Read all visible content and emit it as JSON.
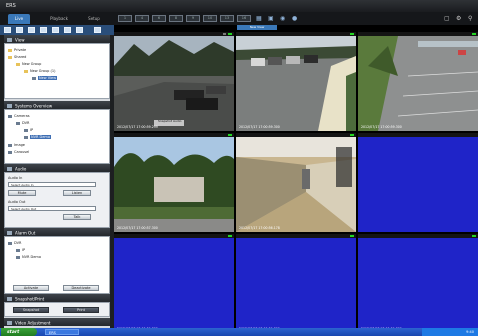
{
  "app": {
    "title": "ERS"
  },
  "tabs": [
    "Live",
    "Playback",
    "Setup"
  ],
  "toolbar": {
    "layout_buttons": [
      "1",
      "4",
      "6",
      "8",
      "9",
      "10",
      "13",
      "16",
      "25",
      "36"
    ],
    "right_icons": [
      "window-icon",
      "gear-icon",
      "search-icon"
    ],
    "extra_icons": [
      "sequence-icon",
      "fullscreen-icon",
      "snapshot-icon",
      "record-icon"
    ]
  },
  "view_tab": "New View",
  "view_panel": {
    "title": "View",
    "tree": [
      {
        "label": "Private",
        "level": 0
      },
      {
        "label": "Shared",
        "level": 0
      },
      {
        "label": "New Group",
        "level": 1
      },
      {
        "label": "New Group (1)",
        "level": 2
      },
      {
        "label": "New View",
        "level": 3,
        "selected": true
      }
    ]
  },
  "systems_panel": {
    "title": "Systems Overview",
    "tree": [
      {
        "label": "Cameras",
        "level": 0
      },
      {
        "label": "DVR",
        "level": 1
      },
      {
        "label": "IP",
        "level": 2
      },
      {
        "label": "NVR Demo",
        "level": 2,
        "selected": true
      },
      {
        "label": "Image",
        "level": 0
      },
      {
        "label": "Carousel",
        "level": 0
      }
    ]
  },
  "audio_panel": {
    "title": "Audio",
    "audio_in_label": "Audio In",
    "audio_in_placeholder": "Select Audio In",
    "mute_label": "Mute",
    "listen_label": "Listen",
    "audio_out_label": "Audio Out",
    "audio_out_placeholder": "Select Audio Out",
    "talk_label": "Talk"
  },
  "alarm_panel": {
    "title": "Alarm Out",
    "tree": [
      {
        "label": "DVR",
        "level": 0
      },
      {
        "label": "IP",
        "level": 1
      },
      {
        "label": "NVR Demo",
        "level": 1
      }
    ],
    "activate_label": "Activate",
    "deactivate_label": "Deactivate"
  },
  "snapshot_panel": {
    "title": "Snapshot/Print",
    "snapshot_label": "Snapshot",
    "print_label": "Print"
  },
  "video_panel": {
    "title": "Video Adjustment"
  },
  "tiles": [
    {
      "caption": "2012/07/17 17:00:59.299",
      "content": "camera",
      "active": true
    },
    {
      "caption": "2012/07/17 17:00:59.300",
      "content": "camera"
    },
    {
      "caption": "2012/07/17 17:00:59.300",
      "content": "camera"
    },
    {
      "caption": "2012/07/17 17:00:57.300",
      "content": "camera"
    },
    {
      "caption": "2012/07/17 17:00:56.178",
      "content": "camera"
    },
    {
      "caption": "",
      "content": "blank"
    },
    {
      "caption": "2012/07/17 17:00:59.300",
      "content": "blank"
    },
    {
      "caption": "2012/07/17 17:00:59.300",
      "content": "blank"
    },
    {
      "caption": "2012/07/17 17:00:59.300",
      "content": "blank"
    }
  ],
  "tile_label": "Snapshot Audio",
  "taskbar": {
    "start": "start",
    "task": "ERS",
    "time": "9:40"
  },
  "colors": {
    "accent": "#3a78b8",
    "active_tile": "#23d623",
    "blank_tile": "#1f24c8"
  }
}
